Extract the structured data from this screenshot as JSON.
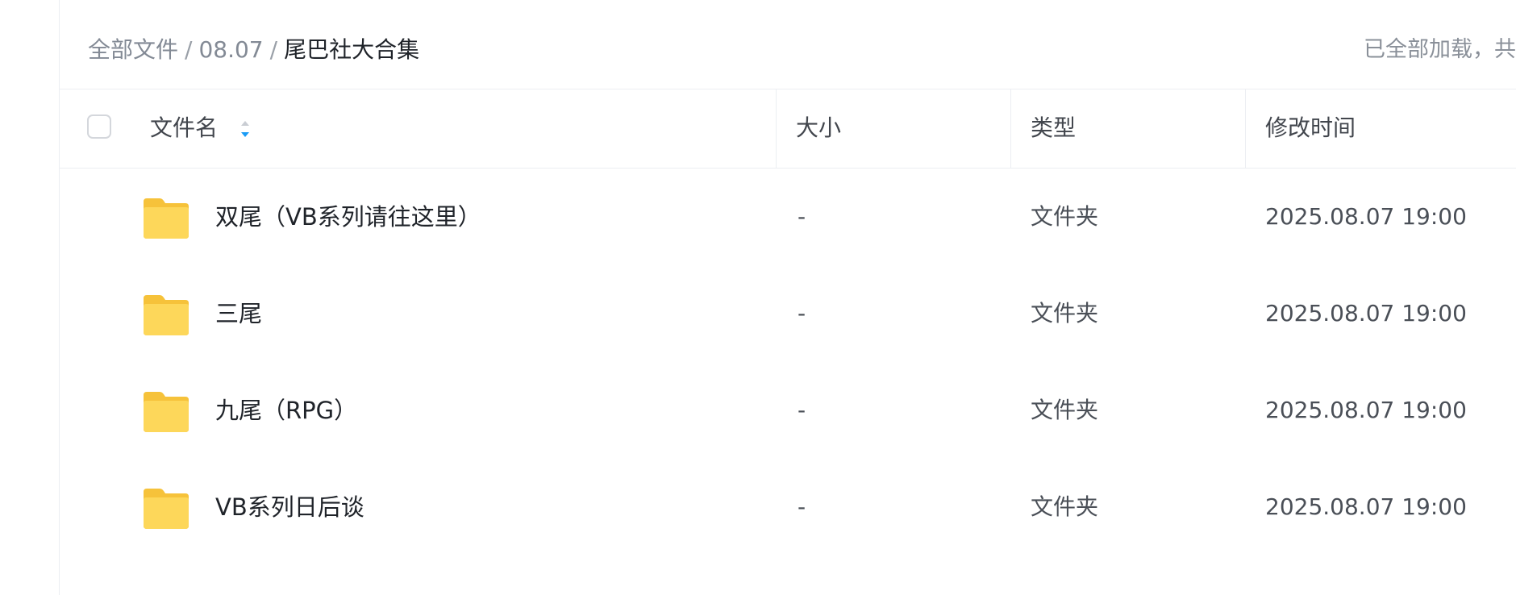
{
  "breadcrumb": {
    "items": [
      "全部文件",
      "08.07"
    ],
    "separator": "/",
    "current": "尾巴社大合集"
  },
  "status": "已全部加载，共",
  "table": {
    "headers": {
      "name": "文件名",
      "size": "大小",
      "type": "类型",
      "modified": "修改时间"
    },
    "sort": {
      "column": "name",
      "direction": "descending",
      "active_color": "#1a9bf5"
    },
    "rows": [
      {
        "name": "双尾（VB系列请往这里）",
        "size": "-",
        "type": "文件夹",
        "modified": "2025.08.07 19:00",
        "icon": "folder-icon"
      },
      {
        "name": "三尾",
        "size": "-",
        "type": "文件夹",
        "modified": "2025.08.07 19:00",
        "icon": "folder-icon"
      },
      {
        "name": "九尾（RPG）",
        "size": "-",
        "type": "文件夹",
        "modified": "2025.08.07 19:00",
        "icon": "folder-icon"
      },
      {
        "name": "VB系列日后谈",
        "size": "-",
        "type": "文件夹",
        "modified": "2025.08.07 19:00",
        "icon": "folder-icon"
      }
    ]
  },
  "colors": {
    "folder_back": "#f6c23a",
    "folder_front": "#fdd75a",
    "divider": "#eceef2",
    "muted_text": "#838a95"
  }
}
